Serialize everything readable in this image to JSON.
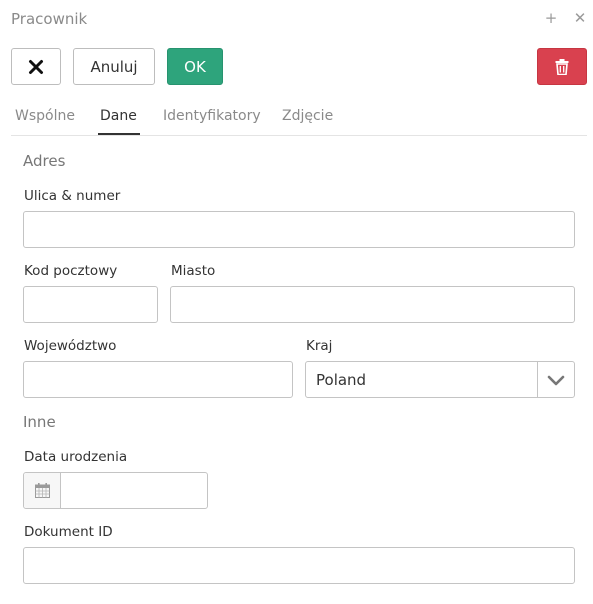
{
  "window": {
    "title": "Pracownik"
  },
  "toolbar": {
    "cancel_label": "Anuluj",
    "ok_label": "OK"
  },
  "colors": {
    "ok_button": "#2ea47c",
    "delete_button": "#d9414f"
  },
  "tabs": [
    {
      "label": "Wspólne",
      "active": false
    },
    {
      "label": "Dane",
      "active": true
    },
    {
      "label": "Identyfikatory",
      "active": false
    },
    {
      "label": "Zdjęcie",
      "active": false
    }
  ],
  "address": {
    "section_title": "Adres",
    "street_label": "Ulica & numer",
    "street_value": "",
    "postal_label": "Kod pocztowy",
    "postal_value": "",
    "city_label": "Miasto",
    "city_value": "",
    "voivodeship_label": "Województwo",
    "voivodeship_value": "",
    "country_label": "Kraj",
    "country_value": "Poland"
  },
  "other": {
    "section_title": "Inne",
    "birthdate_label": "Data urodzenia",
    "birthdate_value": "",
    "document_label": "Dokument ID",
    "document_value": ""
  },
  "icons": {
    "close": "close-icon",
    "delete": "trash-icon",
    "calendar": "calendar-icon",
    "dropdown": "chevron-down-icon"
  }
}
